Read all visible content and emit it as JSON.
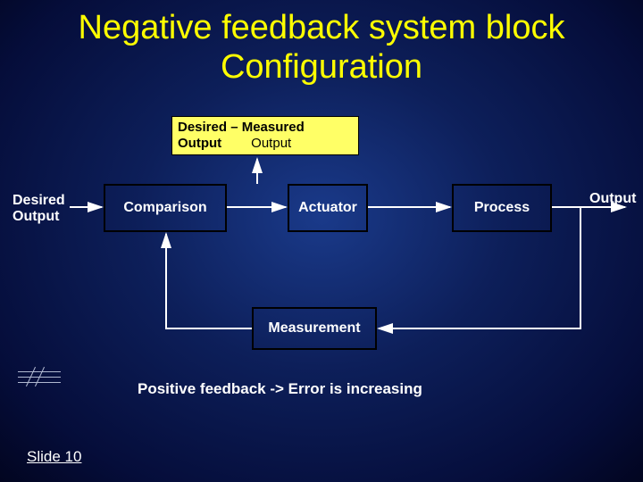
{
  "title": "Negative feedback system block Configuration",
  "labels": {
    "desired_output": "Desired\nOutput",
    "output": "Output"
  },
  "error_signal": {
    "left": "Desired – Measured",
    "left2": "Output",
    "right": "Output"
  },
  "blocks": {
    "comparison": "Comparison",
    "actuator": "Actuator",
    "process": "Process",
    "measurement": "Measurement"
  },
  "note": "Positive feedback -> Error is increasing",
  "footer": "Slide 10",
  "colors": {
    "accent": "#ffff00",
    "error_bg": "#ffff66"
  },
  "chart_data": {
    "type": "diagram",
    "title": "Negative feedback system block Configuration",
    "nodes": [
      {
        "id": "desired_output",
        "kind": "input-label",
        "text": "Desired Output"
      },
      {
        "id": "comparison",
        "kind": "block",
        "text": "Comparison"
      },
      {
        "id": "error_signal",
        "kind": "signal-label",
        "text": "Desired – Measured Output"
      },
      {
        "id": "actuator",
        "kind": "block",
        "text": "Actuator"
      },
      {
        "id": "process",
        "kind": "block",
        "text": "Process"
      },
      {
        "id": "output",
        "kind": "output-label",
        "text": "Output"
      },
      {
        "id": "measurement",
        "kind": "block",
        "text": "Measurement"
      }
    ],
    "edges": [
      {
        "from": "desired_output",
        "to": "comparison"
      },
      {
        "from": "comparison",
        "to": "actuator",
        "label": "error_signal"
      },
      {
        "from": "actuator",
        "to": "process"
      },
      {
        "from": "process",
        "to": "output"
      },
      {
        "from": "output",
        "to": "measurement",
        "note": "feedback tap"
      },
      {
        "from": "measurement",
        "to": "comparison",
        "note": "feedback return"
      }
    ],
    "annotation": "Positive feedback -> Error is increasing"
  }
}
